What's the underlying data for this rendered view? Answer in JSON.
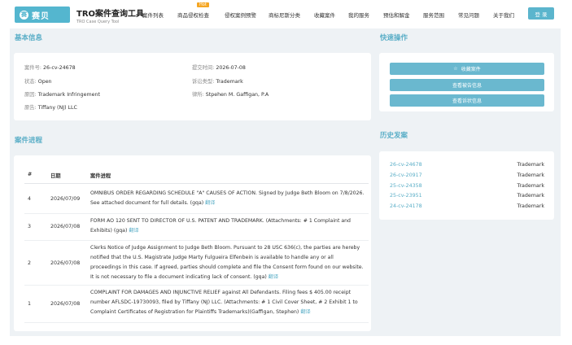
{
  "nav": {
    "logo_mark": "赛",
    "logo_text": "赛贝",
    "title": "TRO案件查询工具",
    "subtitle": "TRO Case Query Tool",
    "hot_badge": "Hot",
    "items": [
      "案件列表",
      "商品侵权检查",
      "侵权案例预警",
      "商标尼斯分类",
      "收藏案件",
      "我的服务",
      "预估和解金",
      "服务范围",
      "常见问题",
      "关于我们"
    ],
    "login": "登 录"
  },
  "basic": {
    "title": "基本信息",
    "case_no_label": "案件号:",
    "case_no": "26-cv-24678",
    "filed_label": "提交时间:",
    "filed": "2026-07-08",
    "status_label": "状态:",
    "status": "Open",
    "type_label": "诉讼类型:",
    "type": "Trademark",
    "cause_label": "原因:",
    "cause": "Trademark Infringement",
    "lawyer_label": "律所:",
    "lawyer": "Stpehen M. Gaffigan, P.A",
    "plaintiff_label": "原告:",
    "plaintiff": "Tiffany (NJ) LLC"
  },
  "quick": {
    "title": "快速操作",
    "favorite": "收藏案件",
    "defendant_info": "查看被告信息",
    "evidence_info": "查看诉状信息"
  },
  "history": {
    "title": "历史发案",
    "cases": [
      {
        "no": "26-cv-24678",
        "type": "Trademark"
      },
      {
        "no": "26-cv-20917",
        "type": "Trademark"
      },
      {
        "no": "25-cv-24358",
        "type": "Trademark"
      },
      {
        "no": "25-cv-23951",
        "type": "Trademark"
      },
      {
        "no": "24-cv-24178",
        "type": "Trademark"
      }
    ]
  },
  "progress": {
    "title": "案件进程",
    "col_no": "#",
    "col_date": "日期",
    "col_desc": "案件进程",
    "translate": "翻译",
    "rows": [
      {
        "no": "4",
        "date": "2026/07/09",
        "desc": "OMNIBUS ORDER REGARDING SCHEDULE \"A\" CAUSES OF ACTION. Signed by Judge Beth Bloom on 7/8/2026. See attached document for full details. (gqa)"
      },
      {
        "no": "3",
        "date": "2026/07/08",
        "desc": "FORM AO 120 SENT TO DIRECTOR OF U.S. PATENT AND TRADEMARK. (Attachments: # 1 Complaint and Exhibits) (gqa)"
      },
      {
        "no": "2",
        "date": "2026/07/08",
        "desc": "Clerks Notice of Judge Assignment to Judge Beth Bloom. Pursuant to 28 USC 636(c), the parties are hereby notified that the U.S. Magistrate Judge Marty Fulgueira Elfenbein is available to handle any or all proceedings in this case. If agreed, parties should complete and file the Consent form found on our website. It is not necessary to file a document indicating lack of consent. (gqa)"
      },
      {
        "no": "1",
        "date": "2026/07/08",
        "desc": "COMPLAINT FOR DAMAGES AND INJUNCTIVE RELIEF against All Defendants. Filing fees $ 405.00 receipt number AFLSDC-19730093, filed by Tiffany (NJ) LLC. (Attachments: # 1 Civil Cover Sheet, # 2 Exhibit 1 to Complaint Certificates of Registration for Plaintiffs Trademarks)(Gaffigan, Stephen)"
      }
    ]
  }
}
